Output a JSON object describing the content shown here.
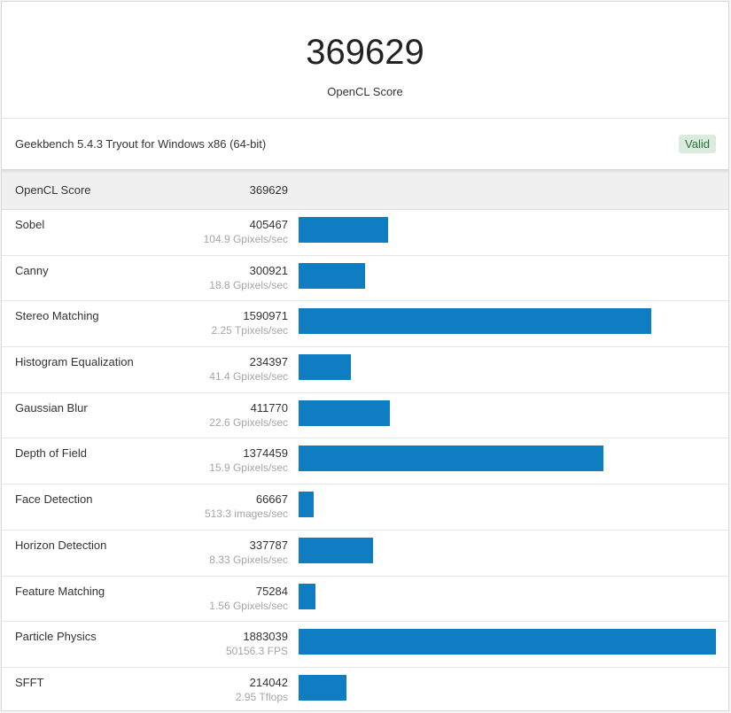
{
  "header": {
    "score": "369629",
    "label": "OpenCL Score"
  },
  "info": {
    "title": "Geekbench 5.4.3 Tryout for Windows x86 (64-bit)",
    "badge": "Valid"
  },
  "summary": {
    "name": "OpenCL Score",
    "value": "369629"
  },
  "colors": {
    "bar": "#0f7dc2",
    "badge_bg": "#d9ecdd",
    "badge_text": "#2f6f3c"
  },
  "chart_data": {
    "type": "bar",
    "max_reference": 1883039,
    "rows": [
      {
        "name": "Sobel",
        "score": 405467,
        "score_text": "405467",
        "unit": "104.9 Gpixels/sec"
      },
      {
        "name": "Canny",
        "score": 300921,
        "score_text": "300921",
        "unit": "18.8 Gpixels/sec"
      },
      {
        "name": "Stereo Matching",
        "score": 1590971,
        "score_text": "1590971",
        "unit": "2.25 Tpixels/sec"
      },
      {
        "name": "Histogram Equalization",
        "score": 234397,
        "score_text": "234397",
        "unit": "41.4 Gpixels/sec"
      },
      {
        "name": "Gaussian Blur",
        "score": 411770,
        "score_text": "411770",
        "unit": "22.6 Gpixels/sec"
      },
      {
        "name": "Depth of Field",
        "score": 1374459,
        "score_text": "1374459",
        "unit": "15.9 Gpixels/sec"
      },
      {
        "name": "Face Detection",
        "score": 66667,
        "score_text": "66667",
        "unit": "513.3 images/sec"
      },
      {
        "name": "Horizon Detection",
        "score": 337787,
        "score_text": "337787",
        "unit": "8.33 Gpixels/sec"
      },
      {
        "name": "Feature Matching",
        "score": 75284,
        "score_text": "75284",
        "unit": "1.56 Gpixels/sec"
      },
      {
        "name": "Particle Physics",
        "score": 1883039,
        "score_text": "1883039",
        "unit": "50156.3 FPS"
      },
      {
        "name": "SFFT",
        "score": 214042,
        "score_text": "214042",
        "unit": "2.95 Tflops"
      }
    ]
  }
}
